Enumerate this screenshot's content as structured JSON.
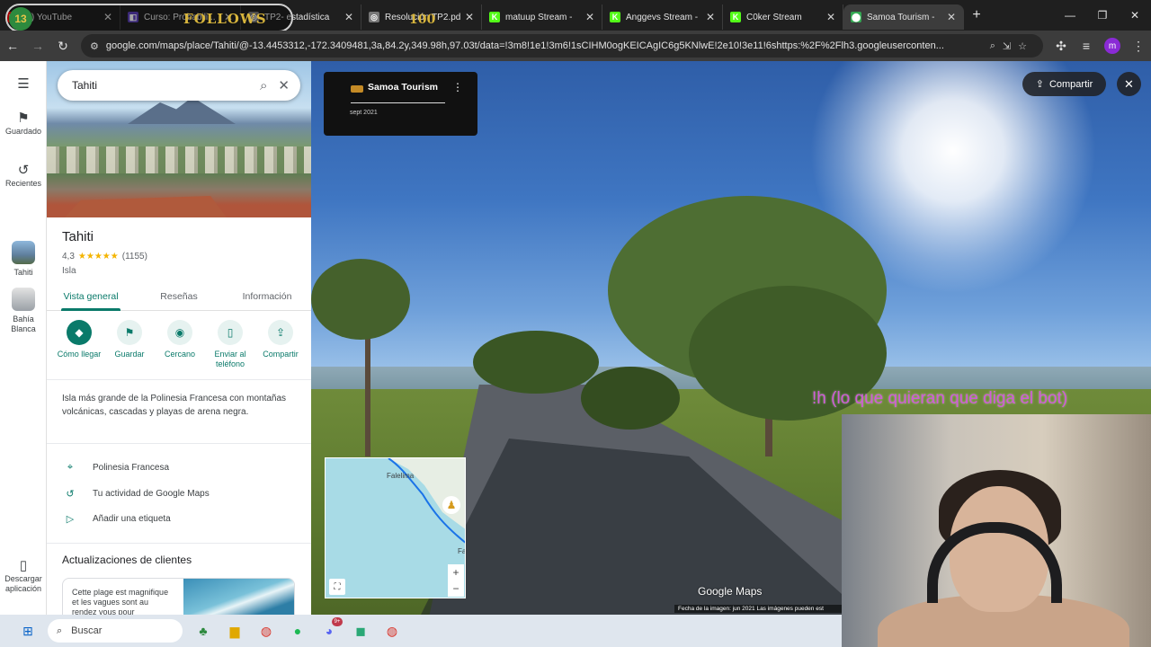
{
  "browser": {
    "tabs": [
      {
        "title": "(8) YouTube",
        "icon": "youtube-icon",
        "color": "#ff0000",
        "glyph": "▶"
      },
      {
        "title": "Curso: Probabili...",
        "icon": "course-icon",
        "color": "#5b3fb8",
        "glyph": "◧"
      },
      {
        "title": "TP2- estadística",
        "icon": "globe-icon",
        "color": "#777777",
        "glyph": "◎"
      },
      {
        "title": "Resolución TP2.pd",
        "icon": "globe-icon",
        "color": "#777777",
        "glyph": "◎"
      },
      {
        "title": "matuup Stream - ",
        "icon": "kick-icon",
        "color": "#53fc18",
        "glyph": "K"
      },
      {
        "title": "Anggevs Stream -",
        "icon": "kick-icon",
        "color": "#53fc18",
        "glyph": "K"
      },
      {
        "title": "C0ker Stream",
        "icon": "kick-icon",
        "color": "#53fc18",
        "glyph": "K"
      },
      {
        "title": "Samoa Tourism - ",
        "icon": "google-maps-icon",
        "color": "#34a853",
        "glyph": "⬤",
        "active": true
      }
    ],
    "url": "google.com/maps/place/Tahiti/@-13.4453312,-172.3409481,3a,84.2y,349.98h,97.03t/data=!3m8!1e1!3m6!1sCIHM0ogKEICAgIC6g5KNlwE!2e10!3e11!6shttps:%2F%2Flh3.googleuserconten...",
    "profile_initial": "m"
  },
  "overlay": {
    "badge_number": "13",
    "follows_label": "FOLLOWS",
    "follows_count": "100",
    "bot_text": "!h (lo que quieran que diga el bot)"
  },
  "rail": {
    "saved": "Guardado",
    "recent": "Recientes",
    "tahiti": "Tahiti",
    "bahia": "Bahía Blanca",
    "download": "Descargar aplicación"
  },
  "panel": {
    "search_value": "Tahiti",
    "title": "Tahiti",
    "rating": "4,3",
    "stars": "★★★★★",
    "reviews": "(1155)",
    "type": "Isla",
    "tabs": [
      "Vista general",
      "Reseñas",
      "Información"
    ],
    "actions": [
      {
        "label": "Cómo llegar",
        "icon": "directions-icon",
        "glyph": "◆"
      },
      {
        "label": "Guardar",
        "icon": "bookmark-icon",
        "glyph": "⚑"
      },
      {
        "label": "Cercano",
        "icon": "nearby-icon",
        "glyph": "◉"
      },
      {
        "label": "Enviar al teléfono",
        "icon": "phone-icon",
        "glyph": "▯"
      },
      {
        "label": "Compartir",
        "icon": "share-icon",
        "glyph": "⇪"
      }
    ],
    "description": "Isla más grande de la Polinesia Francesa con montañas volcánicas, cascadas y playas de arena negra.",
    "info": [
      {
        "label": "Polinesia Francesa",
        "icon": "location-pin-icon",
        "glyph": "⌖"
      },
      {
        "label": "Tu actividad de Google Maps",
        "icon": "history-icon",
        "glyph": "↺"
      },
      {
        "label": "Añadir una etiqueta",
        "icon": "label-icon",
        "glyph": "▷"
      }
    ],
    "updates_title": "Actualizaciones de clientes",
    "update_card_text": "Cette plage est magnifique et les vagues sont au rendez vous pour"
  },
  "streetview": {
    "card_title": "Samoa Tourism",
    "card_date": "sept 2021",
    "share_label": "Compartir",
    "minimap_place": "Falelima",
    "minimap_place2": "Fa",
    "google_logo": "Google Maps",
    "image_date": "Fecha de la imagen: jun 2021     Las imágenes pueden est"
  },
  "taskbar": {
    "search_placeholder": "Buscar",
    "discord_badge": "9+"
  }
}
